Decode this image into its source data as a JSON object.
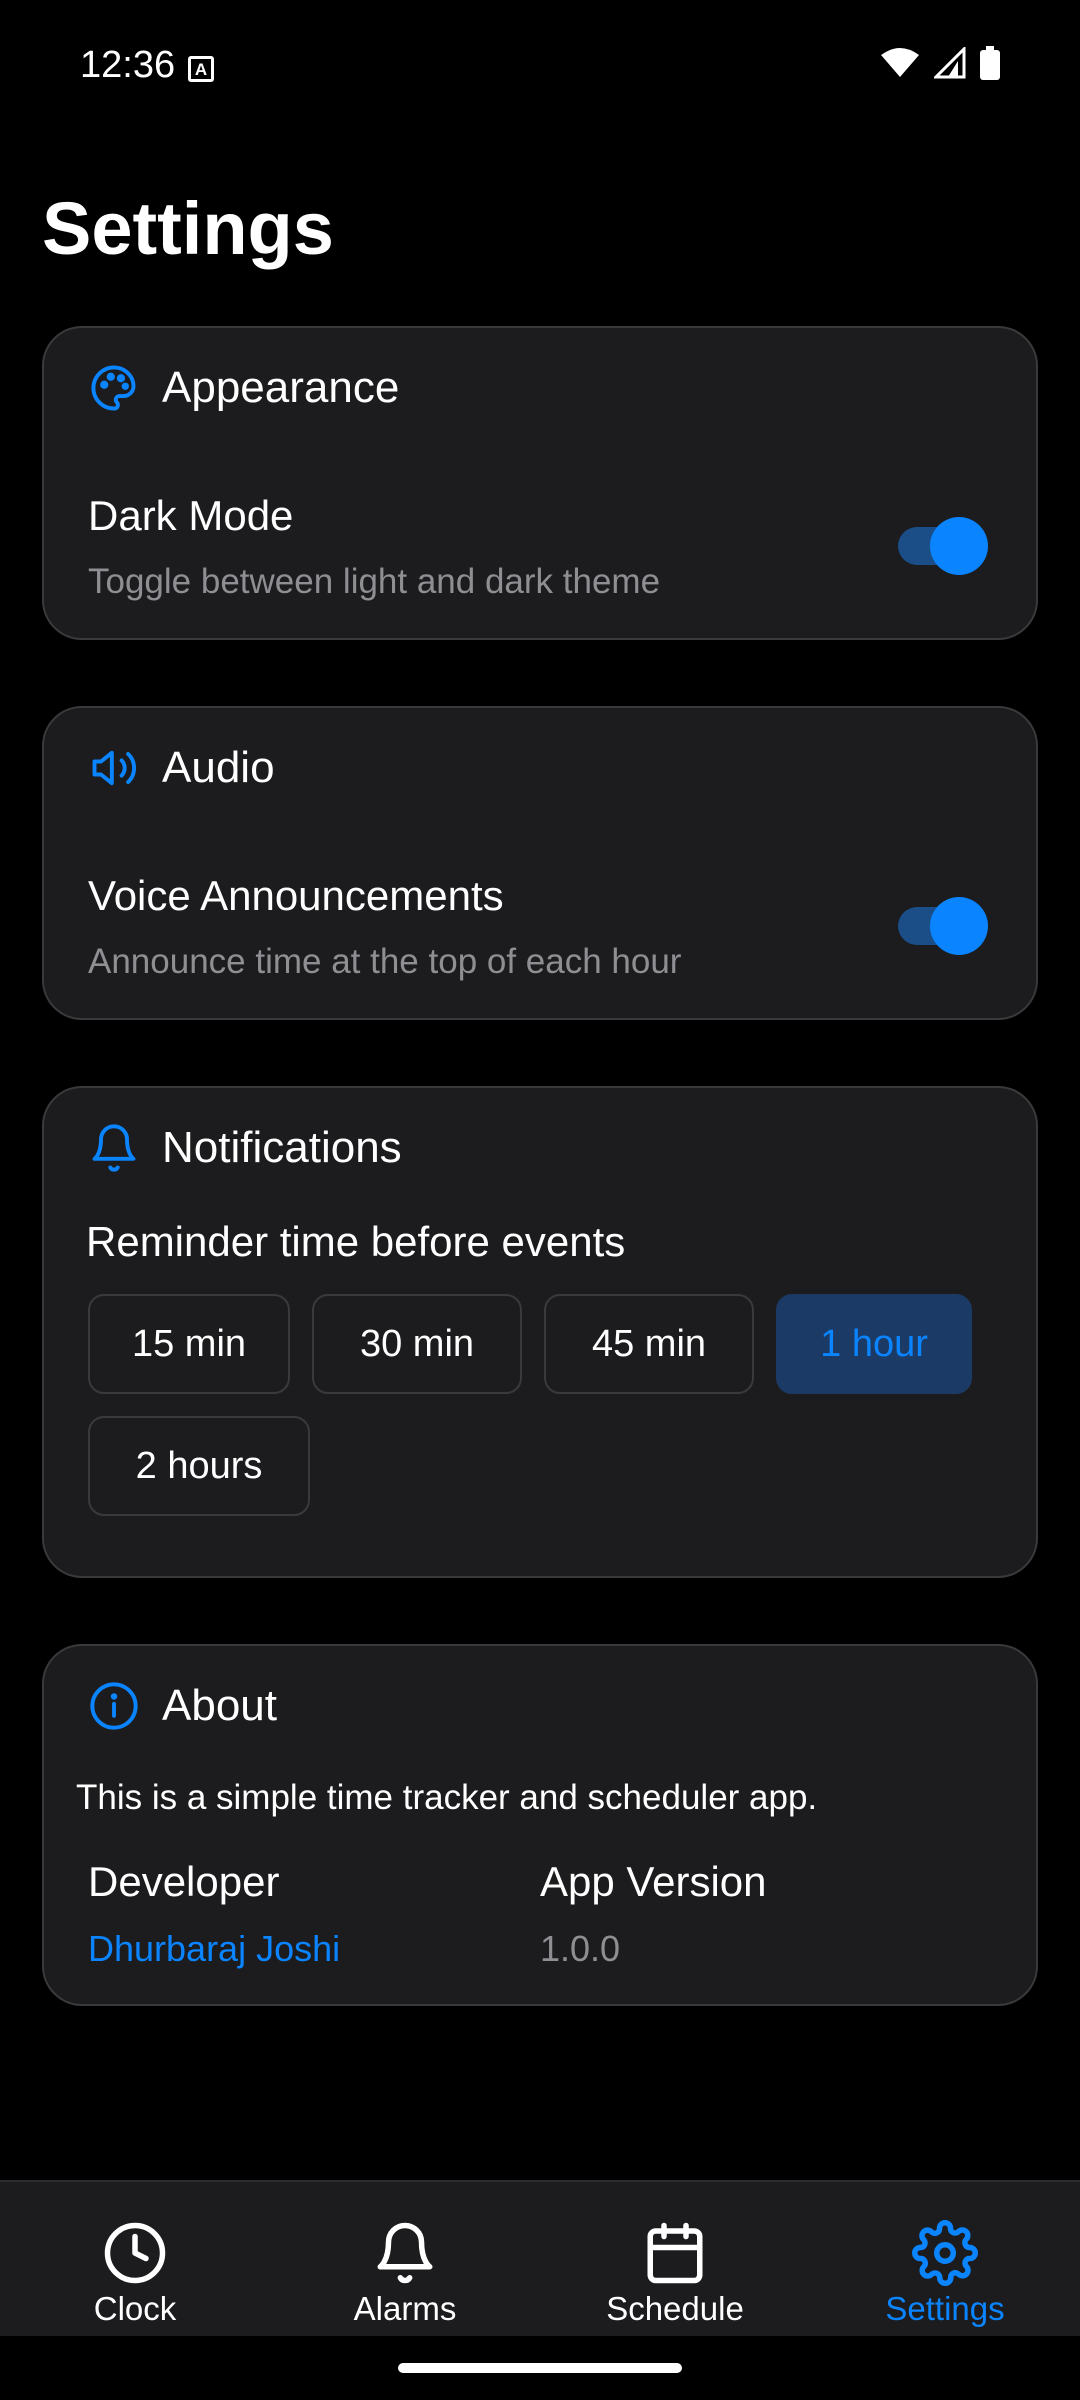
{
  "status_bar": {
    "time": "12:36",
    "badge": "A",
    "icons": [
      "wifi-icon",
      "signal-icon",
      "battery-icon"
    ]
  },
  "page": {
    "title": "Settings"
  },
  "appearance": {
    "icon": "palette-icon",
    "title": "Appearance",
    "dark_mode": {
      "label": "Dark Mode",
      "description": "Toggle between light and dark theme",
      "enabled": true
    }
  },
  "audio": {
    "icon": "speaker-icon",
    "title": "Audio",
    "voice": {
      "label": "Voice Announcements",
      "description": "Announce time at the top of each hour",
      "enabled": true
    }
  },
  "notifications": {
    "icon": "bell-icon",
    "title": "Notifications",
    "reminder_label": "Reminder time before events",
    "options": [
      "15 min",
      "30 min",
      "45 min",
      "1 hour",
      "2 hours"
    ],
    "selected": "1 hour"
  },
  "about": {
    "icon": "info-icon",
    "title": "About",
    "description": "This is a simple time tracker and scheduler app.",
    "developer_label": "Developer",
    "developer_name": "Dhurbaraj Joshi",
    "version_label": "App Version",
    "version": "1.0.0"
  },
  "nav": {
    "items": [
      {
        "label": "Clock",
        "icon": "clock-icon"
      },
      {
        "label": "Alarms",
        "icon": "bell-icon"
      },
      {
        "label": "Schedule",
        "icon": "calendar-icon"
      },
      {
        "label": "Settings",
        "icon": "gear-icon"
      }
    ],
    "active": "Settings"
  },
  "colors": {
    "accent": "#0a84ff",
    "card": "#1c1c1e",
    "background": "#000000",
    "muted": "#8e8e93"
  }
}
